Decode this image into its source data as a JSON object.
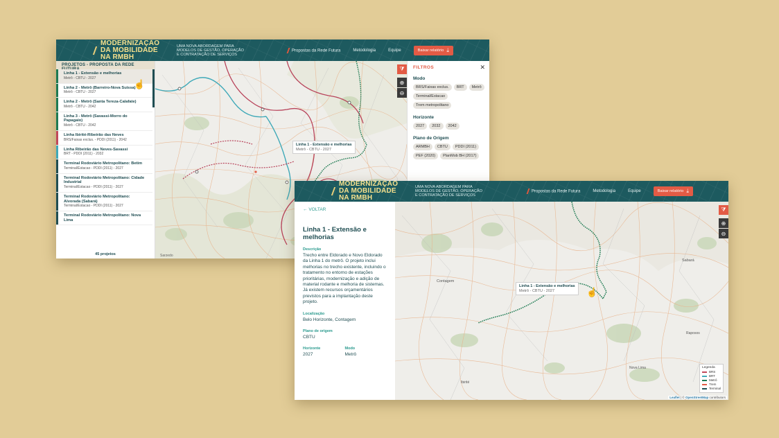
{
  "header": {
    "brand": "MODERNIZAÇÃO DA MOBILIDADE NA RMBH",
    "tagline": "UMA NOVA ABORDAGEM PARA MODELOS DE GESTÃO, OPERAÇÃO E CONTRATAÇÃO DE SERVIÇOS",
    "nav": [
      "Propostas da Rede Futura",
      "Metodologia",
      "Equipe"
    ],
    "download_label": "Baixar relatório",
    "download_icon": "download-icon",
    "colors": {
      "header_bg": "#1d5a5f",
      "brand": "#f5e08c",
      "accent": "#e35b45"
    }
  },
  "list_view": {
    "heading": "PROJETOS - PROPOSTA DA REDE FUTURA",
    "projects": [
      {
        "title": "Linha 1 - Extensão e melhorias",
        "sub": "Metrô - CBTU - 2027",
        "color": "#1d7a52",
        "active": true
      },
      {
        "title": "Linha 2 - Metrô (Barreiro-Nova Suissa)",
        "sub": "Metrô - CBTU - 2027",
        "color": "#1d7a52"
      },
      {
        "title": "Linha 2 - Metrô (Santa Tereza-Calafate)",
        "sub": "Metrô - CBTU - 2042",
        "color": "#1d7a52"
      },
      {
        "title": "Linha 3 - Metrô (Savassi-Morro do Papagaio)",
        "sub": "Metrô - CBTU - 2042",
        "color": "#1d7a52"
      },
      {
        "title": "Linha Ibirité-Ribeirão das Neves",
        "sub": "BRS/Faixas exclus. - PDDI (2011) - 2042",
        "color": "#c0485a"
      },
      {
        "title": "Linha Ribeirão das Neves-Savassi",
        "sub": "BRT - PDDI (2011) - 2032",
        "color": "#3fa9b8"
      },
      {
        "title": "Terminal Rodoviário Metropolitano: Betim",
        "sub": "Terminal/Estacao - PDDI (2011) - 2027",
        "color": "#1f4d52"
      },
      {
        "title": "Terminal Rodoviário Metropolitano: Cidade Industrial",
        "sub": "Terminal/Estacao - PDDI (2011) - 2027",
        "color": "#1f4d52"
      },
      {
        "title": "Terminal Rodoviário Metropolitano: Alvorada (Sabará)",
        "sub": "Terminal/Estacao - PDDI (2011) - 2027",
        "color": "#1f4d52"
      },
      {
        "title": "Terminal Rodoviário Metropolitano: Nova Lima",
        "sub": "",
        "color": "#1f4d52"
      }
    ],
    "count_label": "45 projetos",
    "map_tooltip": {
      "title": "Linha 1 - Extensão e melhorias",
      "sub": "Metrô - CBTU - 2027"
    },
    "map_labels": [
      "Sarzedo"
    ]
  },
  "filters": {
    "title": "FILTROS",
    "close_icon": "close-icon",
    "groups": [
      {
        "label": "Modo",
        "chips": [
          "BRS/Faixas exclus.",
          "BRT",
          "Metrô",
          "Terminal/Estacao",
          "Trem metropolitano"
        ]
      },
      {
        "label": "Horizonte",
        "chips": [
          "2027",
          "2032",
          "2042"
        ]
      },
      {
        "label": "Plano de Origem",
        "chips": [
          "ARMBH",
          "CBTU",
          "PDDI (2011)",
          "PEF (2020)",
          "PlanMob BH (2017)"
        ]
      }
    ]
  },
  "detail_view": {
    "back_label": "VOLTAR",
    "title": "Linha 1 - Extensão e melhorias",
    "description_label": "Descrição",
    "description": "Trecho entre Eldorado e Novo Eldorado da Linha 1 do metrô. O projeto inclui melhorias no trecho existente, incluindo o tratamento no entorno de estações prioritárias, modernização e adição de material rodante e melhoria de sistemas. Já existem recursos orçamentários previstos para a implantação deste projeto.",
    "location_label": "Localização",
    "location": "Belo Horizonte, Contagem",
    "origin_label": "Plano de origem",
    "origin": "CBTU",
    "horizon_label": "Horizonte",
    "horizon": "2027",
    "mode_label": "Modo",
    "mode": "Metrô",
    "map_tooltip": {
      "title": "Linha 1 - Extensão e melhorias",
      "sub": "Metrô - CBTU - 2027"
    },
    "map_labels": [
      "Contagem",
      "Sabará",
      "Raposos",
      "Nova Lima",
      "Ibirité"
    ]
  },
  "legend": {
    "title": "Legenda",
    "items": [
      {
        "label": "BRS",
        "color": "#c0485a"
      },
      {
        "label": "BRT",
        "color": "#3fa9b8"
      },
      {
        "label": "Metrô",
        "color": "#1d7a52"
      },
      {
        "label": "Trem",
        "color": "#e35b45"
      },
      {
        "label": "Terminal",
        "color": "#1f4d52"
      }
    ]
  },
  "attribution": {
    "leaflet": "Leaflet",
    "sep": " | © ",
    "osm": "OpenStreetMap",
    "suffix": " contributors"
  }
}
